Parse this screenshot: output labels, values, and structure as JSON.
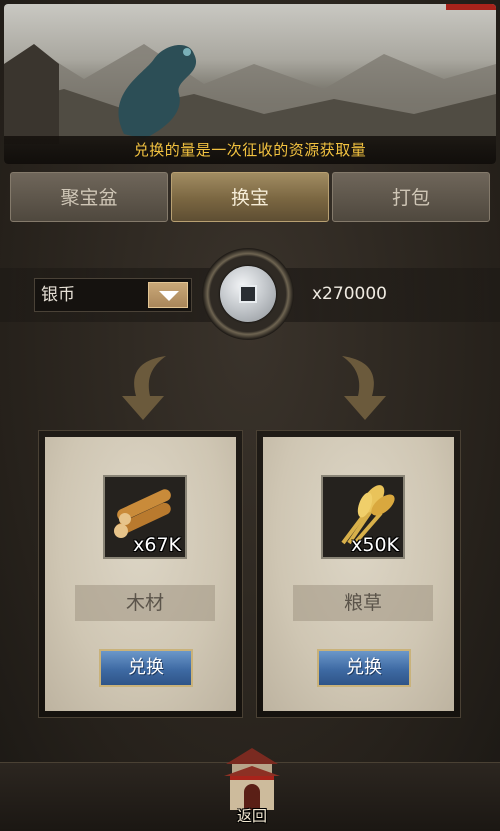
{
  "banner": {
    "caption": "兑换的量是一次征收的资源获取量"
  },
  "tabs": [
    {
      "label": "聚宝盆",
      "active": false
    },
    {
      "label": "换宝",
      "active": true
    },
    {
      "label": "打包",
      "active": false
    }
  ],
  "currency": {
    "selected": "银币",
    "amount": "x270000",
    "icon": "silver-coin-icon"
  },
  "rewards": [
    {
      "name": "木材",
      "count": "x67K",
      "icon": "wood-logs-icon",
      "button": "兑换"
    },
    {
      "name": "粮草",
      "count": "x50K",
      "icon": "wheat-sheaf-icon",
      "button": "兑换"
    }
  ],
  "footer": {
    "return_label": "返回"
  },
  "colors": {
    "caption": "#f2c240",
    "button_blue": "#3e6aa3",
    "accent_red": "#a8231b"
  }
}
